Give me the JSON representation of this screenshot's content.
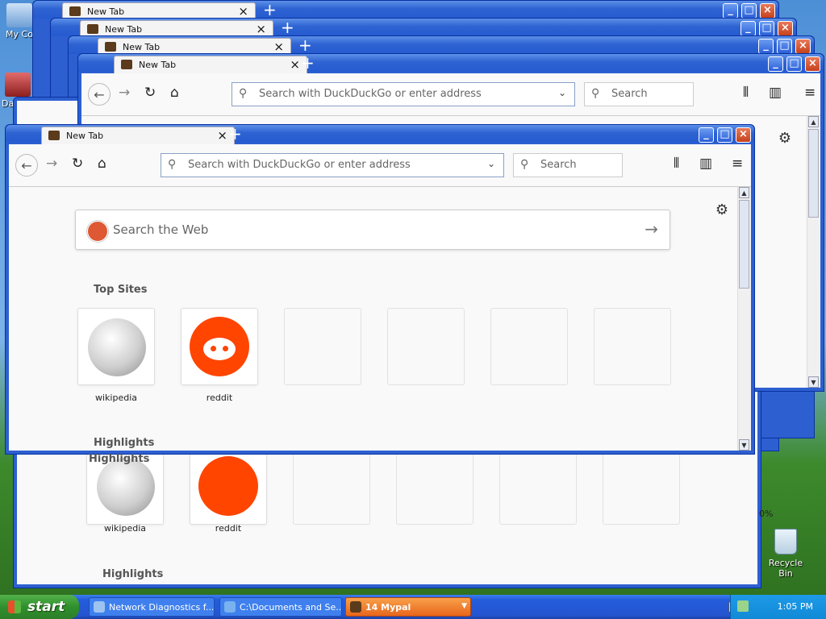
{
  "desktop": {
    "icons": [
      {
        "label": "My Co"
      },
      {
        "label": "DataWa"
      }
    ],
    "recycle_bin": "Recycle Bin"
  },
  "browser": {
    "tab_title": "New Tab",
    "new_tab_symbol": "+",
    "url_placeholder": "Search with DuckDuckGo or enter address",
    "search_placeholder": "Search",
    "web_search_placeholder": "Search the Web",
    "top_sites_heading": "Top Sites",
    "highlights_heading": "Highlights",
    "sites": [
      {
        "label": "wikipedia"
      },
      {
        "label": "reddit"
      }
    ],
    "zoom_fragment": "0%"
  },
  "taskbar": {
    "start_label": "start",
    "tasks": [
      {
        "label": "Network Diagnostics f..."
      },
      {
        "label": "C:\\Documents and Se..."
      },
      {
        "label": "14 Mypal"
      }
    ],
    "clock": "1:05 PM"
  }
}
